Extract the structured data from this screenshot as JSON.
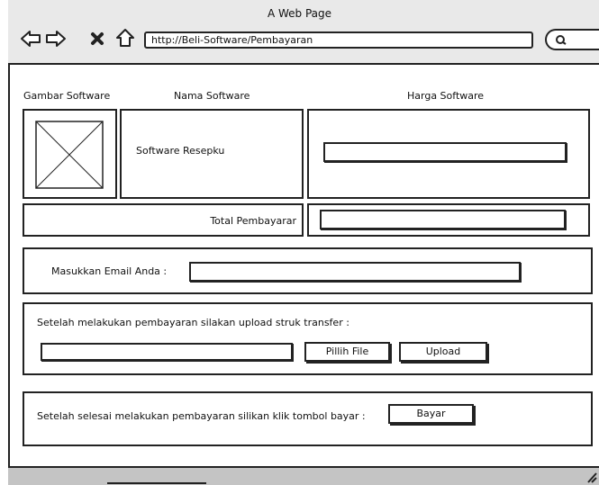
{
  "browser": {
    "title": "A Web Page",
    "url": "http://Beli-Software/Pembayaran"
  },
  "headers": {
    "image": "Gambar Software",
    "name": "Nama Software",
    "price": "Harga Software"
  },
  "product": {
    "name": "Software Resepku",
    "price_value": ""
  },
  "total": {
    "label": "Total Pembayarar",
    "value": ""
  },
  "email": {
    "label": "Masukkan Email Anda :",
    "value": ""
  },
  "upload": {
    "instruction": "Setelah melakukan pembayaran silakan upload struk transfer :",
    "file_value": "",
    "choose_label": "Pillih File",
    "upload_label": "Upload"
  },
  "pay": {
    "instruction": "Setelah selesai melakukan pembayaran silikan klik tombol bayar :",
    "button_label": "Bayar"
  }
}
